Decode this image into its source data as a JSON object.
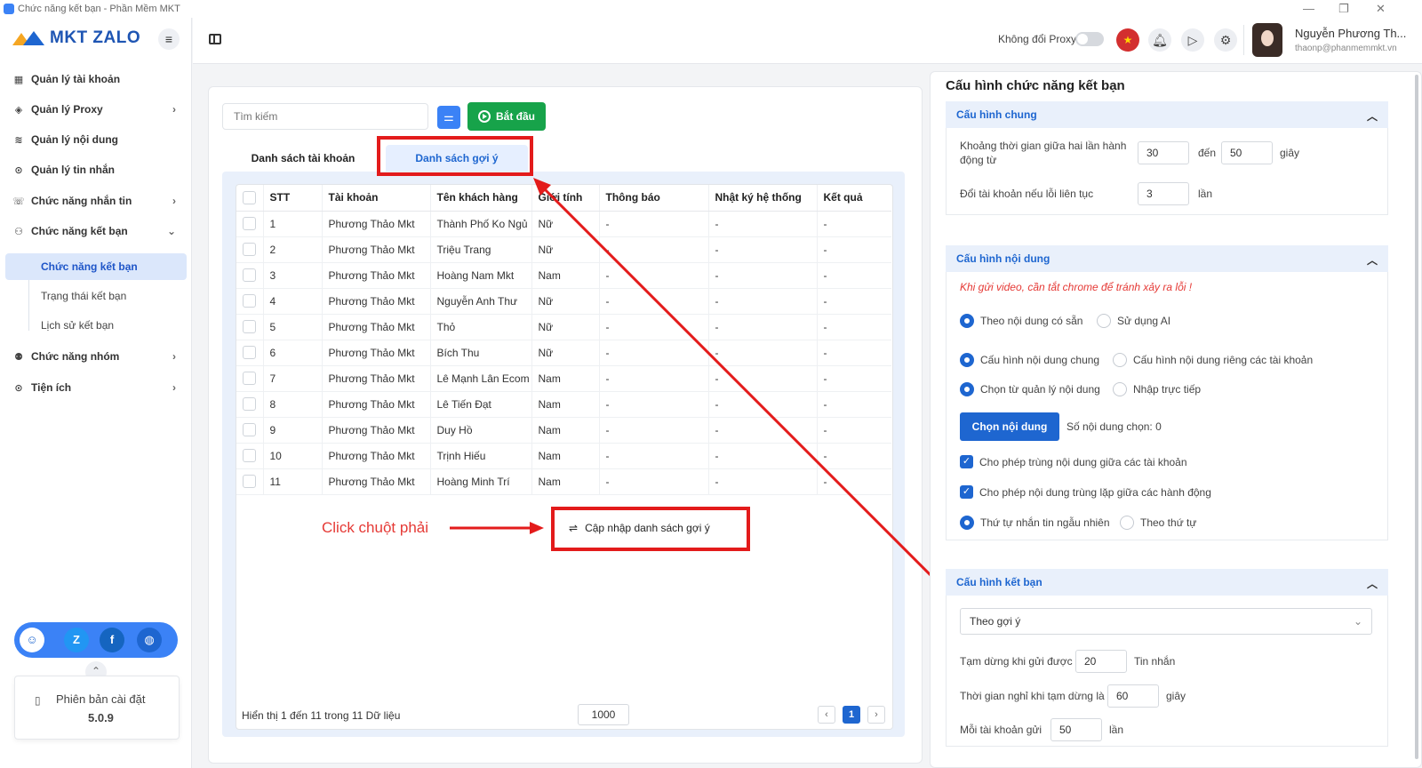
{
  "window": {
    "title": "Chức năng kết bạn - Phần Mềm MKT",
    "controls": [
      "—",
      "❐",
      "✕"
    ]
  },
  "sidebar": {
    "logo": "MKT ZALO",
    "items": [
      {
        "label": "Quản lý tài khoản",
        "icon": "grid-icon",
        "glyph": "▦",
        "chevron": ""
      },
      {
        "label": "Quản lý Proxy",
        "icon": "layers-icon",
        "glyph": "◈",
        "chevron": "›"
      },
      {
        "label": "Quản lý nội dung",
        "icon": "stack-icon",
        "glyph": "≋",
        "chevron": ""
      },
      {
        "label": "Quản lý tin nhắn",
        "icon": "search-message-icon",
        "glyph": "⊙",
        "chevron": ""
      },
      {
        "label": "Chức năng nhắn tin",
        "icon": "chat-icon",
        "glyph": "☏",
        "chevron": "›"
      },
      {
        "label": "Chức năng kết bạn",
        "icon": "add-user-icon",
        "glyph": "⚇",
        "chevron": "⌄"
      }
    ],
    "sub_items": [
      "Chức năng kết bạn",
      "Trạng thái kết bạn",
      "Lịch sử kết bạn"
    ],
    "items2": [
      {
        "label": "Chức năng nhóm",
        "icon": "group-icon",
        "glyph": "⚉",
        "chevron": "›"
      },
      {
        "label": "Tiện ích",
        "icon": "utility-icon",
        "glyph": "⊙",
        "chevron": "›"
      }
    ],
    "version_label": "Phiên bản cài đặt",
    "version": "5.0.9"
  },
  "header": {
    "proxy_label": "Không đổi Proxy",
    "user_name": "Nguyễn Phương Th...",
    "user_email": "thaonp@phanmemmkt.vn"
  },
  "toolbar": {
    "search_placeholder": "Tìm kiếm",
    "start_label": "Bắt đầu"
  },
  "tabs": [
    "Danh sách tài khoản",
    "Danh sách gợi ý"
  ],
  "table": {
    "columns": [
      "STT",
      "Tài khoản",
      "Tên khách hàng",
      "Giới tính",
      "Thông báo",
      "Nhật ký hệ thống",
      "Kết quả"
    ],
    "rows": [
      [
        "1",
        "Phương Thảo Mkt",
        "Thành Phố Ko Ngủ",
        "Nữ",
        "-",
        "-",
        "-"
      ],
      [
        "2",
        "Phương Thảo Mkt",
        "Triệu Trang",
        "Nữ",
        "-",
        "-",
        "-"
      ],
      [
        "3",
        "Phương Thảo Mkt",
        "Hoàng Nam Mkt",
        "Nam",
        "-",
        "-",
        "-"
      ],
      [
        "4",
        "Phương Thảo Mkt",
        "Nguyễn Anh Thư",
        "Nữ",
        "-",
        "-",
        "-"
      ],
      [
        "5",
        "Phương Thảo Mkt",
        "Thỏ",
        "Nữ",
        "-",
        "-",
        "-"
      ],
      [
        "6",
        "Phương Thảo Mkt",
        "Bích Thu",
        "Nữ",
        "-",
        "-",
        "-"
      ],
      [
        "7",
        "Phương Thảo Mkt",
        "Lê Mạnh Lân Ecom",
        "Nam",
        "-",
        "-",
        "-"
      ],
      [
        "8",
        "Phương Thảo Mkt",
        "Lê Tiến Đạt",
        "Nam",
        "-",
        "-",
        "-"
      ],
      [
        "9",
        "Phương Thảo Mkt",
        "Duy Hồ",
        "Nam",
        "-",
        "-",
        "-"
      ],
      [
        "10",
        "Phương Thảo Mkt",
        "Trịnh Hiếu",
        "Nam",
        "-",
        "-",
        "-"
      ],
      [
        "11",
        "Phương Thảo Mkt",
        "Hoàng Minh Trí",
        "Nam",
        "-",
        "-",
        "-"
      ]
    ],
    "footer": "Hiển thị 1 đến 11 trong 11 Dữ liệu",
    "page_size": "1000",
    "current_page": "1",
    "prev": "‹",
    "next": "›"
  },
  "annotation": {
    "click_label": "Click chuột phải",
    "menu_item": "Cập nhập danh sách gợi ý"
  },
  "config": {
    "title": "Cấu hình chức năng kết bạn",
    "general": {
      "title": "Cấu hình chung",
      "interval_label": "Khoảng thời gian giữa hai lần hành động từ",
      "interval_from": "30",
      "to_label": "đến",
      "interval_to": "50",
      "seconds": "giây",
      "switch_label": "Đổi tài khoản nếu lỗi liên tục",
      "switch_value": "3",
      "times": "lần"
    },
    "content": {
      "title": "Cấu hình nội dung",
      "warning": "Khi gửi video, cần tắt chrome để tránh xảy ra lỗi !",
      "opt_available": "Theo nội dung có sẵn",
      "opt_ai": "Sử dụng AI",
      "opt_common": "Cấu hình nội dung chung",
      "opt_separate": "Cấu hình nội dung riêng các tài khoản",
      "opt_from_manager": "Chọn từ quản lý nội dung",
      "opt_direct": "Nhập trực tiếp",
      "pick_button": "Chọn nội dung",
      "picked_count": "Số nội dung chọn: 0",
      "allow_dup_accounts": "Cho phép trùng nội dung giữa các tài khoản",
      "allow_dup_actions": "Cho phép nội dung trùng lặp giữa các hành động",
      "order_random": "Thứ tự nhắn tin ngẫu nhiên",
      "order_sequential": "Theo thứ tự"
    },
    "friend": {
      "title": "Cấu hình kết bạn",
      "mode": "Theo gợi ý",
      "pause_label": "Tạm dừng khi gửi được",
      "pause_value": "20",
      "pause_unit": "Tin nhắn",
      "rest_label": "Thời gian nghỉ khi tạm dừng là",
      "rest_value": "60",
      "rest_unit": "giây",
      "per_account_label": "Mỗi tài khoản gửi",
      "per_account_value": "50",
      "per_account_unit": "lần"
    }
  },
  "colors": {
    "accent": "#1e66d0",
    "start": "#17a34a",
    "annotation": "#e31b1b"
  }
}
